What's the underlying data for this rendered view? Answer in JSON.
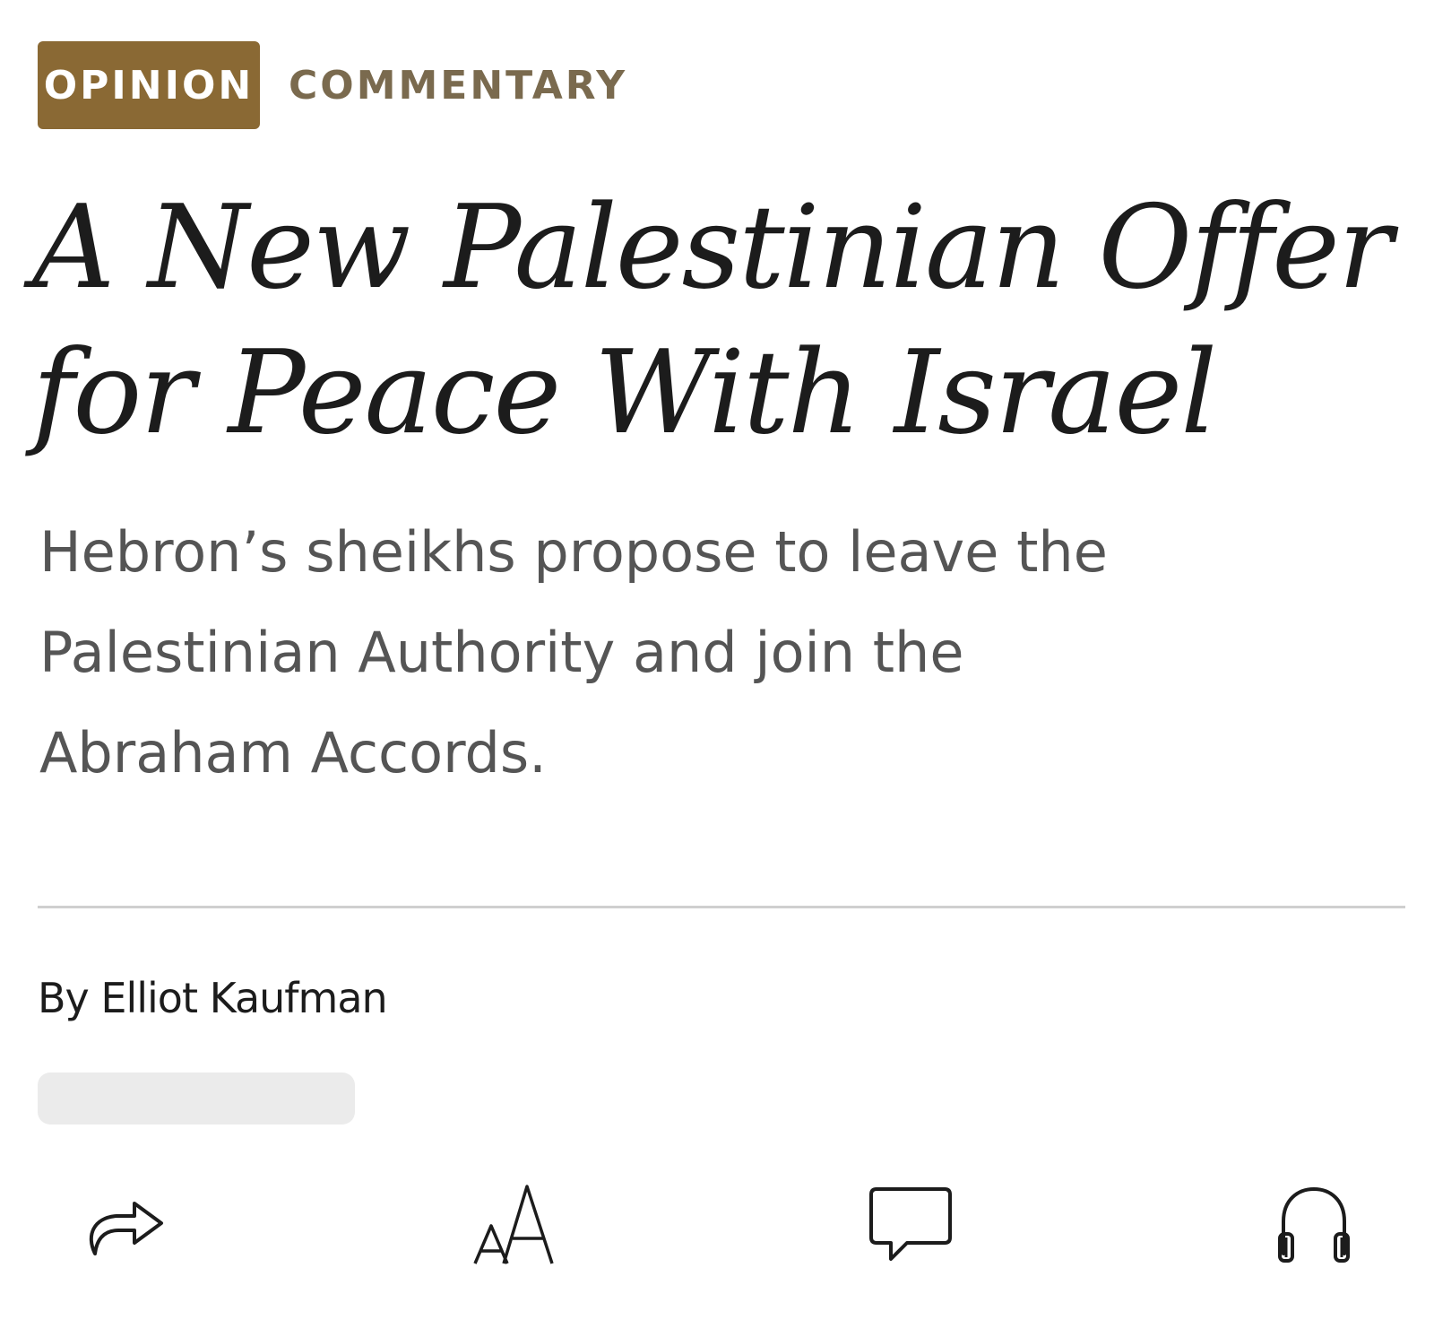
{
  "labels": {
    "section": "OPINION",
    "category": "COMMENTARY"
  },
  "article": {
    "headline_line1": "A New Palestinian Offer",
    "headline_line2": "for Peace With Israel",
    "dek_line1": "Hebron’s sheikhs propose to leave the",
    "dek_line2": "Palestinian Authority and join the",
    "dek_line3": "Abraham Accords.",
    "byline": "By Elliot Kaufman"
  },
  "toolbar": {
    "items": [
      {
        "icon": "share-icon"
      },
      {
        "icon": "text-size-icon"
      },
      {
        "icon": "comment-icon"
      },
      {
        "icon": "headphones-icon"
      }
    ]
  },
  "colors": {
    "badge_bg": "#8a6934",
    "category_text": "#7a6a4e",
    "dek_text": "#555555",
    "divider": "#cfcfcf",
    "placeholder": "#ebebeb"
  }
}
